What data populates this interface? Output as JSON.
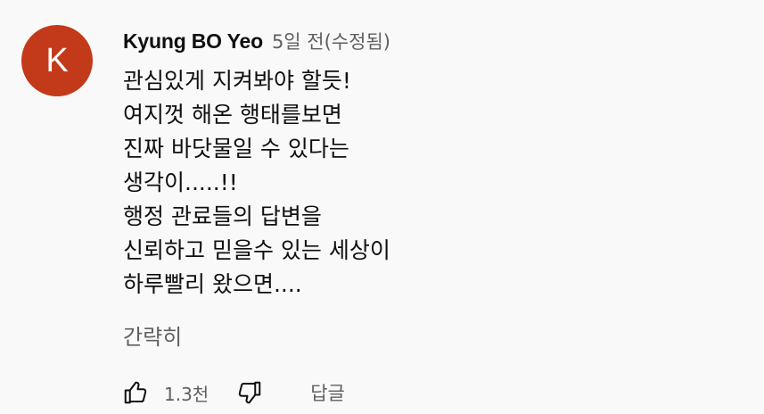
{
  "comment": {
    "avatar": {
      "initial": "K",
      "color": "#c33a1a"
    },
    "author": "Kyung BO Yeo",
    "time": "5일 전(수정됨)",
    "lines": [
      "관심있게 지켜봐야 할듯!",
      "여지껏 해온 행태를보면",
      "진짜 바닷물일 수 있다는",
      "생각이.....!!",
      "행정 관료들의 답변을",
      "신뢰하고 믿을수 있는 세상이",
      "하루빨리 왔으면...."
    ],
    "collapse_label": "간략히",
    "actions": {
      "like_icon": "thumbs-up-icon",
      "like_count": "1.3천",
      "dislike_icon": "thumbs-down-icon",
      "reply_label": "답글"
    }
  }
}
